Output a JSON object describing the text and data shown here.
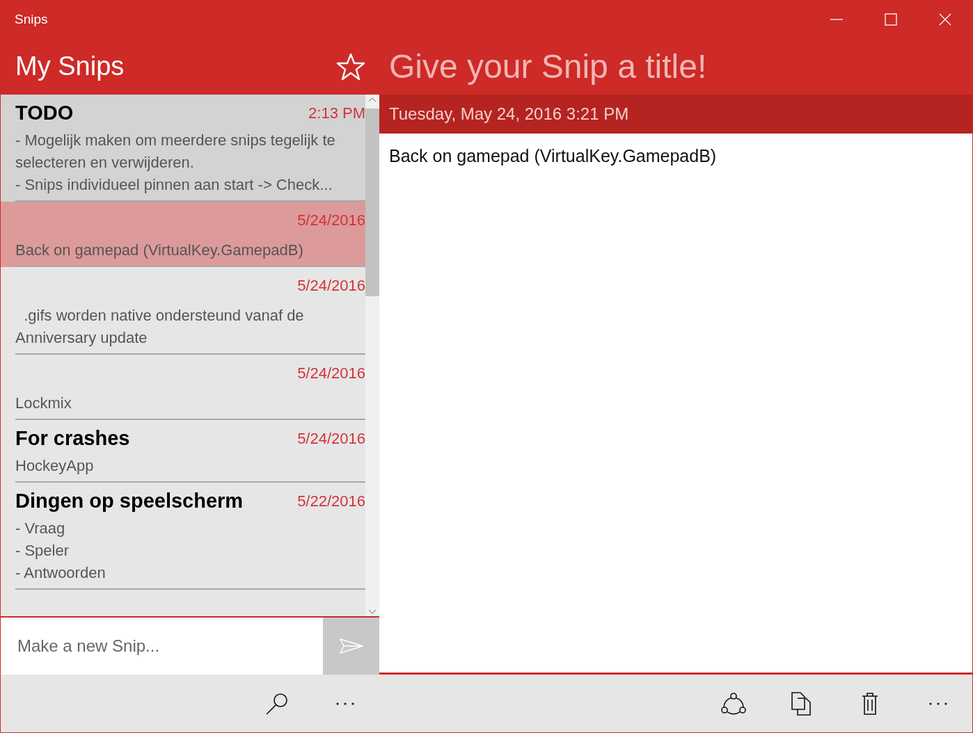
{
  "window": {
    "title": "Snips"
  },
  "list_header": {
    "title": "My Snips"
  },
  "snips": [
    {
      "title": "TODO",
      "date": "2:13 PM",
      "lines": [
        "- Mogelijk maken om meerdere snips tegelijk te",
        "selecteren en verwijderen.",
        "- Snips individueel pinnen aan start -> Check..."
      ],
      "selected": false,
      "hovered": true
    },
    {
      "date": "5/24/2016",
      "lines": [
        "Back on gamepad (VirtualKey.GamepadB)"
      ],
      "selected": true,
      "hovered": false
    },
    {
      "date": "5/24/2016",
      "lines": [
        "  .gifs worden native ondersteund vanaf de",
        "Anniversary update"
      ],
      "selected": false,
      "hovered": false
    },
    {
      "date": "5/24/2016",
      "lines": [
        "Lockmix"
      ],
      "selected": false,
      "hovered": false
    },
    {
      "title": "For crashes",
      "date": "5/24/2016",
      "lines": [
        "HockeyApp"
      ],
      "selected": false,
      "hovered": false
    },
    {
      "title": "Dingen op speelscherm",
      "date": "5/22/2016",
      "lines": [
        "- Vraag",
        "- Speler",
        "- Antwoorden"
      ],
      "selected": false,
      "hovered": false
    }
  ],
  "new_snip": {
    "placeholder": "Make a new Snip..."
  },
  "detail": {
    "title_placeholder": "Give your Snip a title!",
    "date": "Tuesday, May 24, 2016 3:21 PM",
    "body": "Back on gamepad (VirtualKey.GamepadB)"
  }
}
